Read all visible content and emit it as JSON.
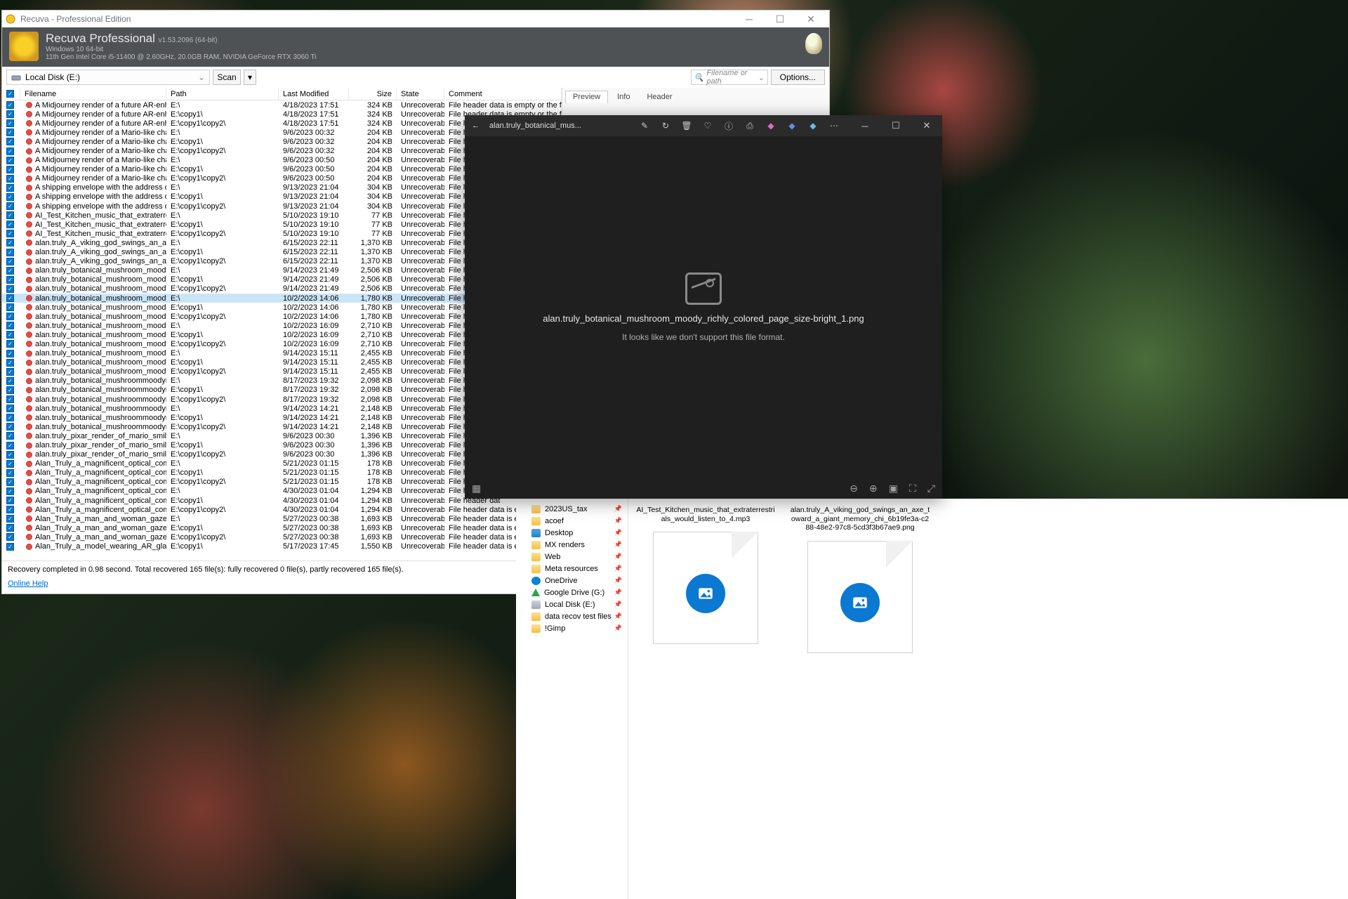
{
  "recuva": {
    "title": "Recuva - Professional Edition",
    "header_name": "Recuva Professional",
    "header_ver": "v1.53.2096  (64-bit)",
    "header_os": "Windows 10 64-bit",
    "header_hw": "11th Gen Intel Core i5-11400 @ 2.60GHz, 20.0GB RAM, NVIDIA GeForce RTX 3060 Ti",
    "drive": "Local Disk (E:)",
    "scan": "Scan",
    "filter": "Filename or path",
    "options": "Options...",
    "columns": {
      "name": "Filename",
      "path": "Path",
      "date": "Last Modified",
      "size": "Size",
      "state": "State",
      "comment": "Comment"
    },
    "side_tabs": {
      "preview": "Preview",
      "info": "Info",
      "header": "Header"
    },
    "status": "Recovery completed in 0.98 second. Total recovered 165 file(s): fully recovered 0 file(s), partly recovered 165 file(s).",
    "help": "Online Help",
    "state_text": "Unrecoverable",
    "comment_full": "File header data is empty or the file is securely del",
    "comment_short": "File header dat",
    "comment_mid": "File header data is empty or the file",
    "rows": [
      {
        "name": "A Midjourney render of a future AR-enhanced hou...",
        "path": "E:\\",
        "date": "4/18/2023 17:51",
        "size": "324 KB",
        "c": "full"
      },
      {
        "name": "A Midjourney render of a future AR-enhanced hou...",
        "path": "E:\\copy1\\",
        "date": "4/18/2023 17:51",
        "size": "324 KB",
        "c": "full"
      },
      {
        "name": "A Midjourney render of a future AR-enhanced hou...",
        "path": "E:\\copy1\\copy2\\",
        "date": "4/18/2023 17:51",
        "size": "324 KB",
        "c": "short"
      },
      {
        "name": "A Midjourney render of a Mario-like character wear...",
        "path": "E:\\",
        "date": "9/6/2023 00:32",
        "size": "204 KB",
        "c": "short"
      },
      {
        "name": "A Midjourney render of a Mario-like character wear...",
        "path": "E:\\copy1\\",
        "date": "9/6/2023 00:32",
        "size": "204 KB",
        "c": "short"
      },
      {
        "name": "A Midjourney render of a Mario-like character wear...",
        "path": "E:\\copy1\\copy2\\",
        "date": "9/6/2023 00:32",
        "size": "204 KB",
        "c": "short"
      },
      {
        "name": "A Midjourney render of a Mario-like character with ...",
        "path": "E:\\",
        "date": "9/6/2023 00:50",
        "size": "204 KB",
        "c": "short"
      },
      {
        "name": "A Midjourney render of a Mario-like character with ...",
        "path": "E:\\copy1\\",
        "date": "9/6/2023 00:50",
        "size": "204 KB",
        "c": "short"
      },
      {
        "name": "A Midjourney render of a Mario-like character with ...",
        "path": "E:\\copy1\\copy2\\",
        "date": "9/6/2023 00:50",
        "size": "204 KB",
        "c": "short"
      },
      {
        "name": "A shipping envelope with the address of the White ...",
        "path": "E:\\",
        "date": "9/13/2023 21:04",
        "size": "304 KB",
        "c": "short"
      },
      {
        "name": "A shipping envelope with the address of the White ...",
        "path": "E:\\copy1\\",
        "date": "9/13/2023 21:04",
        "size": "304 KB",
        "c": "short"
      },
      {
        "name": "A shipping envelope with the address of the White ...",
        "path": "E:\\copy1\\copy2\\",
        "date": "9/13/2023 21:04",
        "size": "304 KB",
        "c": "short"
      },
      {
        "name": "AI_Test_Kitchen_music_that_extraterrestrials_would...",
        "path": "E:\\",
        "date": "5/10/2023 19:10",
        "size": "77 KB",
        "c": "short"
      },
      {
        "name": "AI_Test_Kitchen_music_that_extraterrestrials_would...",
        "path": "E:\\copy1\\",
        "date": "5/10/2023 19:10",
        "size": "77 KB",
        "c": "short"
      },
      {
        "name": "AI_Test_Kitchen_music_that_extraterrestrials_would...",
        "path": "E:\\copy1\\copy2\\",
        "date": "5/10/2023 19:10",
        "size": "77 KB",
        "c": "short"
      },
      {
        "name": "alan.truly_A_viking_god_swings_an_axe_toward_a_...",
        "path": "E:\\",
        "date": "6/15/2023 22:11",
        "size": "1,370 KB",
        "c": "short"
      },
      {
        "name": "alan.truly_A_viking_god_swings_an_axe_toward_a_...",
        "path": "E:\\copy1\\",
        "date": "6/15/2023 22:11",
        "size": "1,370 KB",
        "c": "short"
      },
      {
        "name": "alan.truly_A_viking_god_swings_an_axe_toward_a_...",
        "path": "E:\\copy1\\copy2\\",
        "date": "6/15/2023 22:11",
        "size": "1,370 KB",
        "c": "short"
      },
      {
        "name": "alan.truly_botanical_mushroom_moody_richly_col...",
        "path": "E:\\",
        "date": "9/14/2023 21:49",
        "size": "2,506 KB",
        "c": "short"
      },
      {
        "name": "alan.truly_botanical_mushroom_moody_richly_col...",
        "path": "E:\\copy1\\",
        "date": "9/14/2023 21:49",
        "size": "2,506 KB",
        "c": "short"
      },
      {
        "name": "alan.truly_botanical_mushroom_moody_richly_col...",
        "path": "E:\\copy1\\copy2\\",
        "date": "9/14/2023 21:49",
        "size": "2,506 KB",
        "c": "short"
      },
      {
        "name": "alan.truly_botanical_mushroom_moody_richly_col...",
        "path": "E:\\",
        "date": "10/2/2023 14:06",
        "size": "1,780 KB",
        "c": "short",
        "sel": true
      },
      {
        "name": "alan.truly_botanical_mushroom_moody_richly_col...",
        "path": "E:\\copy1\\",
        "date": "10/2/2023 14:06",
        "size": "1,780 KB",
        "c": "short"
      },
      {
        "name": "alan.truly_botanical_mushroom_moody_richly_col...",
        "path": "E:\\copy1\\copy2\\",
        "date": "10/2/2023 14:06",
        "size": "1,780 KB",
        "c": "short"
      },
      {
        "name": "alan.truly_botanical_mushroom_moody_richly_col...",
        "path": "E:\\",
        "date": "10/2/2023 16:09",
        "size": "2,710 KB",
        "c": "short"
      },
      {
        "name": "alan.truly_botanical_mushroom_moody_richly_col...",
        "path": "E:\\copy1\\",
        "date": "10/2/2023 16:09",
        "size": "2,710 KB",
        "c": "short"
      },
      {
        "name": "alan.truly_botanical_mushroom_moody_richly_col...",
        "path": "E:\\copy1\\copy2\\",
        "date": "10/2/2023 16:09",
        "size": "2,710 KB",
        "c": "short"
      },
      {
        "name": "alan.truly_botanical_mushroom_moody_richly_col...",
        "path": "E:\\",
        "date": "9/14/2023 15:11",
        "size": "2,455 KB",
        "c": "short"
      },
      {
        "name": "alan.truly_botanical_mushroom_moody_richly_col...",
        "path": "E:\\copy1\\",
        "date": "9/14/2023 15:11",
        "size": "2,455 KB",
        "c": "short"
      },
      {
        "name": "alan.truly_botanical_mushroom_moody_richly_col...",
        "path": "E:\\copy1\\copy2\\",
        "date": "9/14/2023 15:11",
        "size": "2,455 KB",
        "c": "short"
      },
      {
        "name": "alan.truly_botanical_mushroommoodyrichly_color...",
        "path": "E:\\",
        "date": "8/17/2023 19:32",
        "size": "2,098 KB",
        "c": "short"
      },
      {
        "name": "alan.truly_botanical_mushroommoodyrichly_color...",
        "path": "E:\\copy1\\",
        "date": "8/17/2023 19:32",
        "size": "2,098 KB",
        "c": "short"
      },
      {
        "name": "alan.truly_botanical_mushroommoodyrichly_color...",
        "path": "E:\\copy1\\copy2\\",
        "date": "8/17/2023 19:32",
        "size": "2,098 KB",
        "c": "short"
      },
      {
        "name": "alan.truly_botanical_mushroommoodyrichly_color...",
        "path": "E:\\",
        "date": "9/14/2023 14:21",
        "size": "2,148 KB",
        "c": "short"
      },
      {
        "name": "alan.truly_botanical_mushroommoodyrichly_color...",
        "path": "E:\\copy1\\",
        "date": "9/14/2023 14:21",
        "size": "2,148 KB",
        "c": "short"
      },
      {
        "name": "alan.truly_botanical_mushroommoodyrichly_color...",
        "path": "E:\\copy1\\copy2\\",
        "date": "9/14/2023 14:21",
        "size": "2,148 KB",
        "c": "short"
      },
      {
        "name": "alan.truly_pixar_render_of_mario_smiling_eyes_cov...",
        "path": "E:\\",
        "date": "9/6/2023 00:30",
        "size": "1,396 KB",
        "c": "short"
      },
      {
        "name": "alan.truly_pixar_render_of_mario_smiling_eyes_cov...",
        "path": "E:\\copy1\\",
        "date": "9/6/2023 00:30",
        "size": "1,396 KB",
        "c": "short"
      },
      {
        "name": "alan.truly_pixar_render_of_mario_smiling_eyes_cov...",
        "path": "E:\\copy1\\copy2\\",
        "date": "9/6/2023 00:30",
        "size": "1,396 KB",
        "c": "short"
      },
      {
        "name": "Alan_Truly_a_magnificent_optical_computer_radiat...",
        "path": "E:\\",
        "date": "5/21/2023 01:15",
        "size": "178 KB",
        "c": "short"
      },
      {
        "name": "Alan_Truly_a_magnificent_optical_computer_radiat...",
        "path": "E:\\copy1\\",
        "date": "5/21/2023 01:15",
        "size": "178 KB",
        "c": "short"
      },
      {
        "name": "Alan_Truly_a_magnificent_optical_computer_radiat...",
        "path": "E:\\copy1\\copy2\\",
        "date": "5/21/2023 01:15",
        "size": "178 KB",
        "c": "short"
      },
      {
        "name": "Alan_Truly_a_magnificent_optical_computer_radiat...",
        "path": "E:\\",
        "date": "4/30/2023 01:04",
        "size": "1,294 KB",
        "c": "short"
      },
      {
        "name": "Alan_Truly_a_magnificent_optical_computer_radiat...",
        "path": "E:\\copy1\\",
        "date": "4/30/2023 01:04",
        "size": "1,294 KB",
        "c": "short"
      },
      {
        "name": "Alan_Truly_a_magnificent_optical_computer_radiat...",
        "path": "E:\\copy1\\copy2\\",
        "date": "4/30/2023 01:04",
        "size": "1,294 KB",
        "c": "mid"
      },
      {
        "name": "Alan_Truly_a_man_and_woman_gaze_with_wonder...",
        "path": "E:\\",
        "date": "5/27/2023 00:38",
        "size": "1,693 KB",
        "c": "mid"
      },
      {
        "name": "Alan_Truly_a_man_and_woman_gaze_with_wonder...",
        "path": "E:\\copy1\\",
        "date": "5/27/2023 00:38",
        "size": "1,693 KB",
        "c": "mid"
      },
      {
        "name": "Alan_Truly_a_man_and_woman_gaze_with_wonder...",
        "path": "E:\\copy1\\copy2\\",
        "date": "5/27/2023 00:38",
        "size": "1,693 KB",
        "c": "mid"
      },
      {
        "name": "Alan_Truly_a_model_wearing_AR_glasses_one_hand...",
        "path": "E:\\copy1\\",
        "date": "5/17/2023 17:45",
        "size": "1,550 KB",
        "c": "mid"
      }
    ]
  },
  "photos": {
    "title": "alan.truly_botanical_mus...",
    "file": "alan.truly_botanical_mushroom_moody_richly_colored_page_size-bright_1.png",
    "msg": "It looks like we don't support this file format."
  },
  "explorer": {
    "nav": [
      {
        "label": "2023US_tax",
        "icon": "folder",
        "pin": true
      },
      {
        "label": "acoef",
        "icon": "folder",
        "pin": true
      },
      {
        "label": "Desktop",
        "icon": "desktop",
        "pin": true
      },
      {
        "label": "MX renders",
        "icon": "folder",
        "pin": true
      },
      {
        "label": "Web",
        "icon": "folder",
        "pin": true
      },
      {
        "label": "Meta resources",
        "icon": "folder",
        "pin": true
      },
      {
        "label": "OneDrive",
        "icon": "onedrive",
        "pin": true
      },
      {
        "label": "Google Drive (G:)",
        "icon": "gdrive",
        "pin": true
      },
      {
        "label": "Local Disk (E:)",
        "icon": "drive",
        "pin": true
      },
      {
        "label": "data recov test files",
        "icon": "folder",
        "pin": true
      },
      {
        "label": "!Gimp",
        "icon": "folder",
        "pin": true
      }
    ],
    "thumbs": [
      {
        "label": "AI_Test_Kitchen_music_that_extraterrestrials_would_listen_to_4.mp3"
      },
      {
        "label": "alan.truly_A_viking_god_swings_an_axe_toward_a_giant_memory_chi_6b19fe3a-c288-48e2-97c8-5cd3f3b67ae9.png"
      }
    ]
  }
}
